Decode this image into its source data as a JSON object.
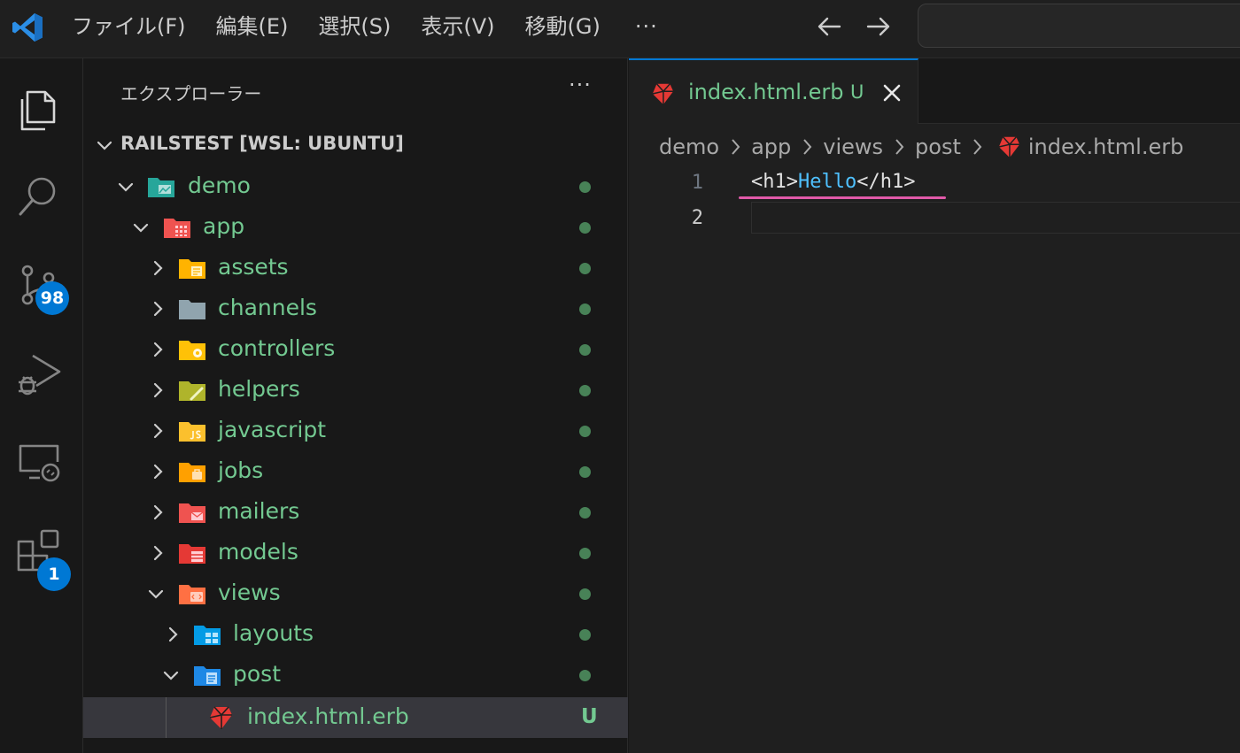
{
  "menu": {
    "items": [
      "ファイル(F)",
      "編集(E)",
      "選択(S)",
      "表示(V)",
      "移動(G)"
    ],
    "more": "···"
  },
  "activity": {
    "source_control_badge": "98",
    "extensions_badge": "1"
  },
  "sidebar": {
    "title": "エクスプローラー",
    "more": "···",
    "root": "RAILSTEST [WSL: UBUNTU]",
    "tree": [
      {
        "label": "demo",
        "icon": "folder-demo-icon",
        "expanded": true
      },
      {
        "label": "app",
        "icon": "folder-app-icon",
        "expanded": true
      },
      {
        "label": "assets",
        "icon": "folder-assets-icon",
        "expanded": false
      },
      {
        "label": "channels",
        "icon": "folder-channels-icon",
        "expanded": false
      },
      {
        "label": "controllers",
        "icon": "folder-controllers-icon",
        "expanded": false
      },
      {
        "label": "helpers",
        "icon": "folder-helpers-icon",
        "expanded": false
      },
      {
        "label": "javascript",
        "icon": "folder-javascript-icon",
        "expanded": false
      },
      {
        "label": "jobs",
        "icon": "folder-jobs-icon",
        "expanded": false
      },
      {
        "label": "mailers",
        "icon": "folder-mailers-icon",
        "expanded": false
      },
      {
        "label": "models",
        "icon": "folder-models-icon",
        "expanded": false
      },
      {
        "label": "views",
        "icon": "folder-views-icon",
        "expanded": true
      },
      {
        "label": "layouts",
        "icon": "folder-layouts-icon",
        "expanded": false
      },
      {
        "label": "post",
        "icon": "folder-post-icon",
        "expanded": true
      },
      {
        "label": "index.html.erb",
        "icon": "erb-file-icon",
        "status": "U"
      }
    ]
  },
  "editor": {
    "tab": {
      "label": "index.html.erb",
      "status": "U"
    },
    "breadcrumb": [
      "demo",
      "app",
      "views",
      "post",
      "index.html.erb"
    ],
    "lines": [
      {
        "number": "1",
        "open_tag": "<h1>",
        "text": "Hello",
        "close_tag": "</h1>"
      },
      {
        "number": "2"
      }
    ]
  },
  "colors": {
    "accent": "#0078d4",
    "untracked": "#73c991",
    "squiggle": "#e15aa9"
  }
}
